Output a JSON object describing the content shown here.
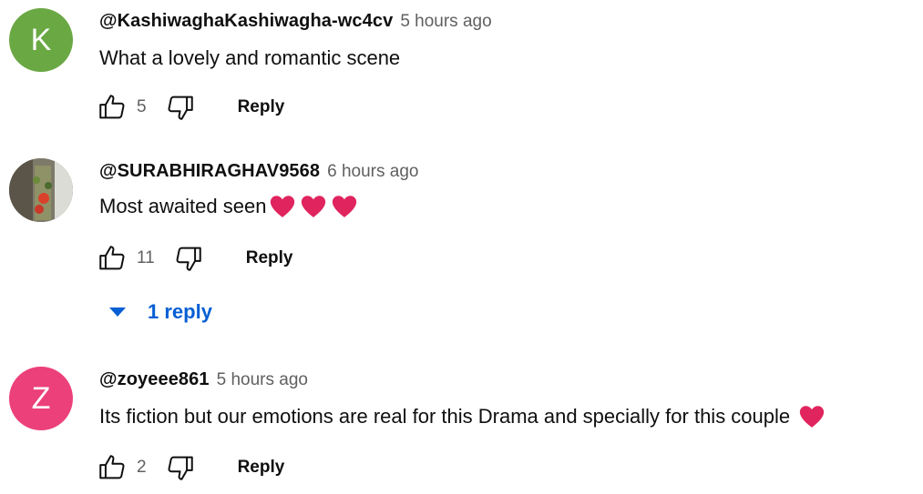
{
  "comments": [
    {
      "avatar_letter": "K",
      "avatar_color": "#6aa843",
      "author": "@KashiwaghaKashiwagha-wc4cv",
      "time": "5 hours ago",
      "text": "What a lovely and romantic scene",
      "hearts": 0,
      "likes": "5",
      "reply_label": "Reply"
    },
    {
      "avatar_letter": "",
      "avatar_color": "#8a8a7a",
      "author": "@SURABHIRAGHAV9568",
      "time": "6 hours ago",
      "text": "Most awaited seen",
      "hearts": 3,
      "likes": "11",
      "reply_label": "Reply",
      "replies_label": "1 reply"
    },
    {
      "avatar_letter": "Z",
      "avatar_color": "#ec407a",
      "author": "@zoyeee861",
      "time": "5 hours ago",
      "text": "Its fiction but our emotions are real for this Drama and specially for this couple",
      "hearts": 1,
      "likes": "2",
      "reply_label": "Reply"
    }
  ],
  "icons": {
    "like": "thumb-up-icon",
    "dislike": "thumb-down-icon",
    "heart": "red-heart-emoji",
    "expand": "caret-down-icon"
  },
  "colors": {
    "link_blue": "#065fd4",
    "heart_red": "#e0245e"
  }
}
